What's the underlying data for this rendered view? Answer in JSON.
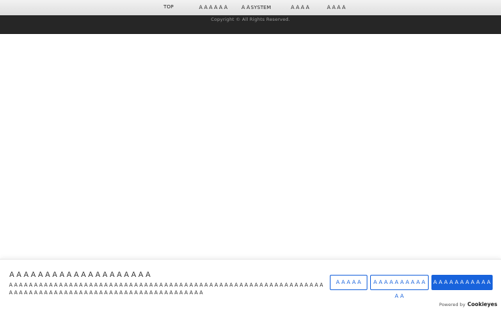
{
  "nav": {
    "items": [
      {
        "label": "TOP"
      },
      {
        "label": "ＡＡＡＡＡＡ"
      },
      {
        "label": "ＡＡSYSTEM"
      },
      {
        "label": "ＡＡＡＡ"
      },
      {
        "label": "ＡＡＡＡ"
      }
    ]
  },
  "footer": {
    "copyright": "Copyright © All Rights Reserved."
  },
  "cookie": {
    "title": "ＡＡＡＡＡＡＡＡＡＡＡＡＡＡＡＡＡＡＡＡ",
    "description": "ＡＡＡＡＡＡＡＡＡＡＡＡＡＡＡＡＡＡＡＡＡＡＡＡＡＡＡＡＡＡＡＡＡＡＡＡＡＡＡＡＡＡＡＡＡＡＡＡＡＡＡＡＡＡＡＡＡＡＡＡＡＡＡＡＡＡＡＡＡＡＡＡＡＡＡＡＡＡＡＡＡＡＡＡＡＡＡＡＡＡＡＡＡＡＡＡＡＡＡＡＡＡ",
    "customize_label": "ＡＡＡＡＡ",
    "reject_label": "ＡＡＡＡＡＡＡＡＡＡＡＡ",
    "accept_label": "ＡＡＡＡＡＡＡＡＡＡＡＡ",
    "powered_by": "Powered by",
    "brand": "Cookieyes"
  },
  "colors": {
    "accent": "#1863dc",
    "footer_bg": "#262626",
    "nav_bg": "#e8e8e8"
  }
}
